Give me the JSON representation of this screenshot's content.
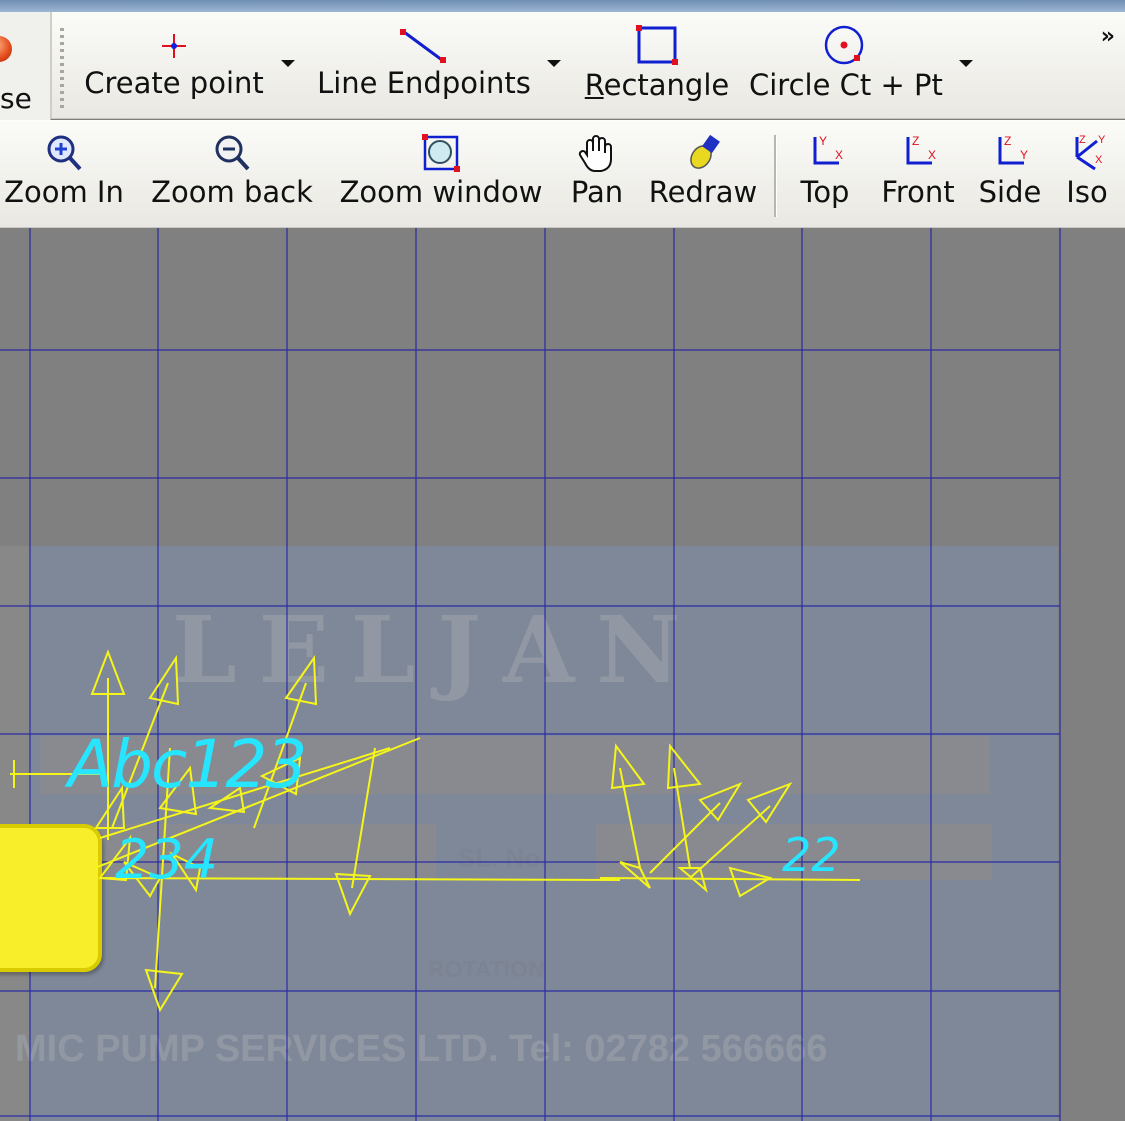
{
  "left_panel": {
    "partial_label": "se"
  },
  "toolbar_draw": {
    "buttons": [
      {
        "label": "Create point",
        "icon": "create-point-icon",
        "has_dropdown": true
      },
      {
        "label": "Line Endpoints",
        "icon": "line-endpoints-icon",
        "has_dropdown": true
      },
      {
        "label": "Rectangle",
        "icon": "rectangle-icon",
        "has_dropdown": false
      },
      {
        "label": "Circle Ct + Pt",
        "icon": "circle-center-point-icon",
        "has_dropdown": true
      }
    ],
    "overflow_label": "»"
  },
  "toolbar_view": {
    "buttons": [
      {
        "label": "Zoom In",
        "icon": "zoom-in-icon"
      },
      {
        "label": "Zoom back",
        "icon": "zoom-back-icon"
      },
      {
        "label": "Zoom window",
        "icon": "zoom-window-icon"
      },
      {
        "label": "Pan",
        "icon": "pan-hand-icon"
      },
      {
        "label": "Redraw",
        "icon": "redraw-icon"
      },
      {
        "label": "Top",
        "icon": "top-view-icon"
      },
      {
        "label": "Front",
        "icon": "front-view-icon"
      },
      {
        "label": "Side",
        "icon": "side-view-icon"
      },
      {
        "label": "Iso",
        "icon": "iso-view-icon"
      }
    ]
  },
  "canvas": {
    "background_image_text": {
      "brand": "LELJAN",
      "serial_label": "SL. No.",
      "rotation": "ROTATION",
      "company": "MIC PUMP SERVICES LTD.   Tel: 02782 566666"
    },
    "cad_texts": [
      "Abc123",
      "234",
      "22"
    ],
    "colors": {
      "grid": "#1c1ca8",
      "vectors": "#f5f51a",
      "text": "#27e4ff"
    }
  }
}
